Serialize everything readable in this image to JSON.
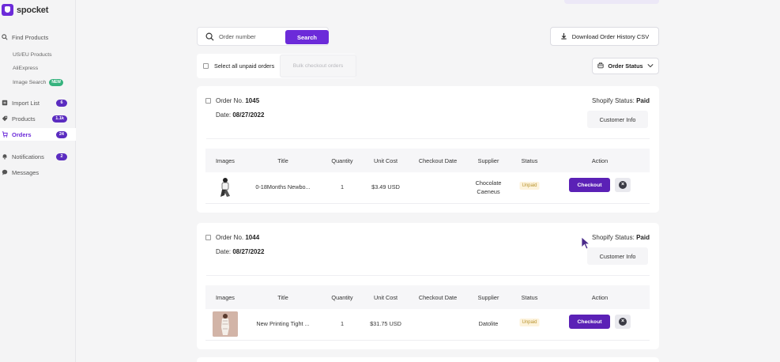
{
  "brand": {
    "name": "spocket"
  },
  "sidebar": {
    "items": [
      {
        "label": "Find Products",
        "icon": "search-icon"
      },
      {
        "label": "US/EU Products"
      },
      {
        "label": "AliExpress"
      },
      {
        "label": "Image Search",
        "badge": "NEW"
      },
      {
        "label": "Import List",
        "icon": "list-icon",
        "badge": "6"
      },
      {
        "label": "Products",
        "icon": "tag-icon",
        "badge": "1.1k"
      },
      {
        "label": "Orders",
        "icon": "cart-icon",
        "badge": "24"
      },
      {
        "label": "Notifications",
        "icon": "bell-icon",
        "badge": "2"
      },
      {
        "label": "Messages",
        "icon": "chat-icon"
      }
    ]
  },
  "search": {
    "placeholder": "Order number",
    "button": "Search"
  },
  "download_label": "Download Order History CSV",
  "select_all_label": "Select all unpaid orders",
  "bulk_checkout_label": "Bulk checkout orders",
  "order_status_label": "Order Status",
  "table_headers": [
    "Images",
    "Title",
    "Quantity",
    "Unit Cost",
    "Checkout Date",
    "Supplier",
    "Status",
    "Action"
  ],
  "orders": [
    {
      "order_prefix": "Order No.",
      "number": "1045",
      "date_prefix": "Date:",
      "date": "08/27/2022",
      "shopify_prefix": "Shopify Status:",
      "shopify_status": "Paid",
      "customer_info": "Customer Info",
      "item": {
        "title": "0-18Months Newbo...",
        "quantity": "1",
        "unit_cost": "$3.49 USD",
        "checkout_date": "",
        "supplier": "Chocolate Caeneus",
        "status": "Unpaid",
        "action": "Checkout"
      }
    },
    {
      "order_prefix": "Order No.",
      "number": "1044",
      "date_prefix": "Date:",
      "date": "08/27/2022",
      "shopify_prefix": "Shopify Status:",
      "shopify_status": "Paid",
      "customer_info": "Customer Info",
      "item": {
        "title": "New Printing Tight ...",
        "quantity": "1",
        "unit_cost": "$31.75 USD",
        "checkout_date": "",
        "supplier": "Datolite",
        "status": "Unpaid",
        "action": "Checkout"
      }
    }
  ],
  "colors": {
    "accent": "#6c2bd9",
    "badge": "#5b2cc0",
    "new_badge": "#36b37e",
    "unpaid_bg": "#fdf3dc",
    "unpaid_text": "#b8932f"
  }
}
